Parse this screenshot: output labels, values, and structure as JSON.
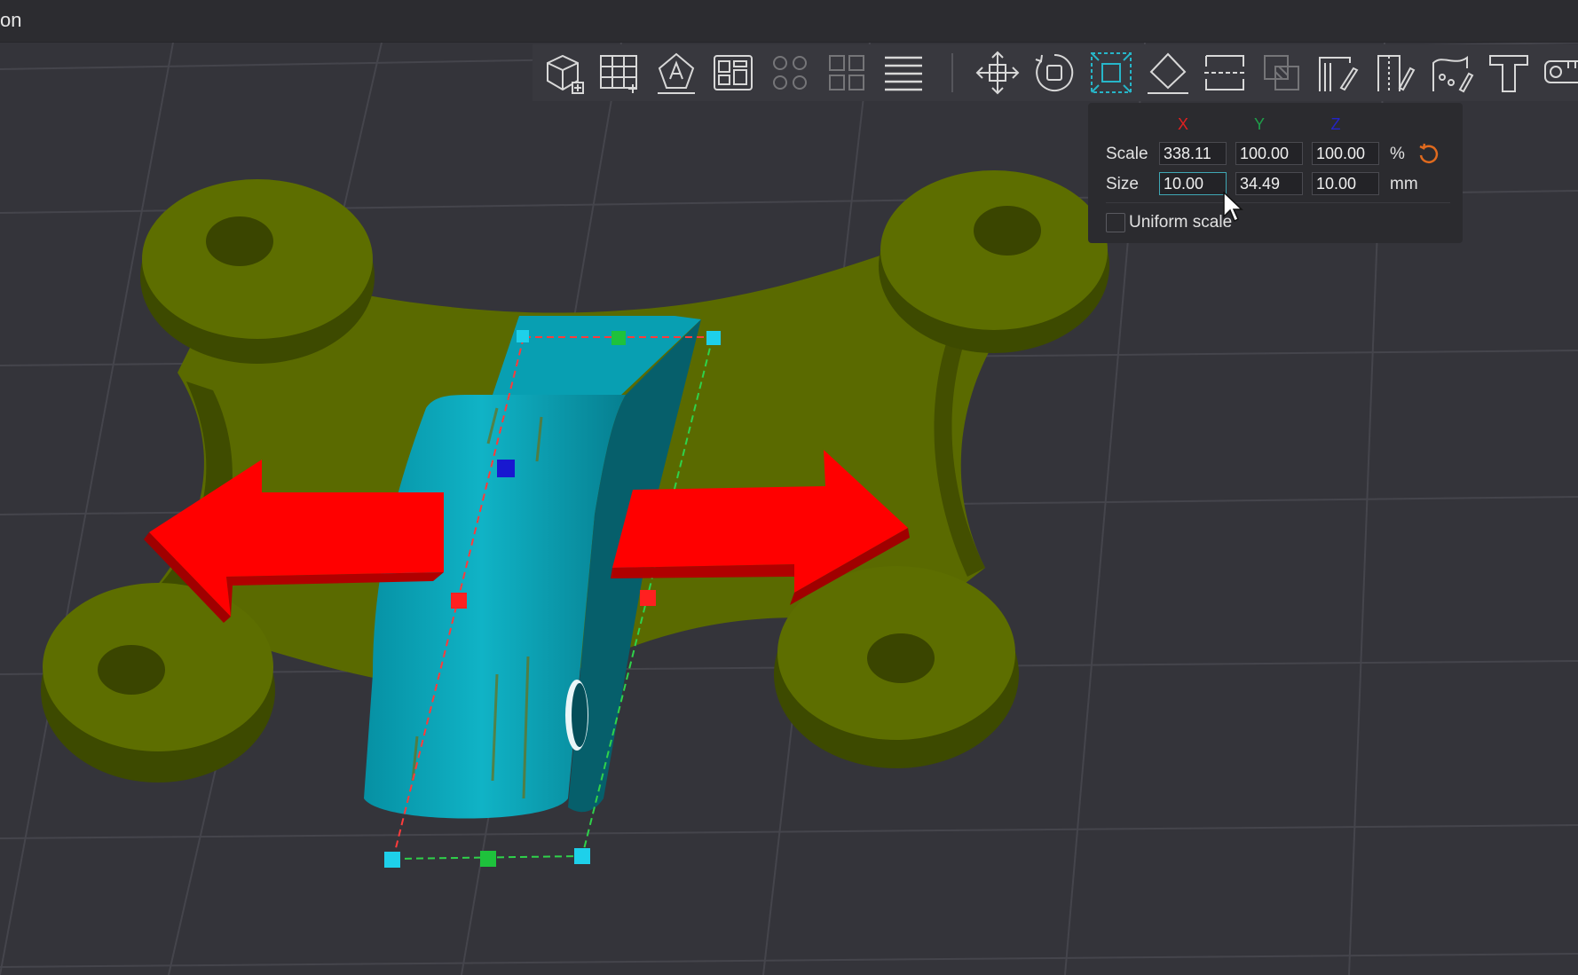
{
  "window": {
    "title": "on"
  },
  "toolbar": {
    "buttons": [
      {
        "name": "add-cube-icon"
      },
      {
        "name": "arrange-grid-icon"
      },
      {
        "name": "auto-orient-icon"
      },
      {
        "name": "plate-layout-icon"
      },
      {
        "name": "split-objects-icon"
      },
      {
        "name": "split-parts-icon"
      },
      {
        "name": "layers-icon"
      },
      {
        "name": "move-icon"
      },
      {
        "name": "rotate-icon"
      },
      {
        "name": "scale-icon"
      },
      {
        "name": "lay-on-face-icon"
      },
      {
        "name": "cut-icon"
      },
      {
        "name": "mesh-boolean-icon"
      },
      {
        "name": "support-paint-icon"
      },
      {
        "name": "seam-paint-icon"
      },
      {
        "name": "color-paint-icon"
      },
      {
        "name": "text-icon"
      },
      {
        "name": "measure-icon"
      }
    ]
  },
  "scale_panel": {
    "axis_x": "X",
    "axis_y": "Y",
    "axis_z": "Z",
    "scale_label": "Scale",
    "scale_x": "338.11",
    "scale_y": "100.00",
    "scale_z": "100.00",
    "scale_unit": "%",
    "size_label": "Size",
    "size_x": "10.00",
    "size_y": "34.49",
    "size_z": "10.00",
    "size_unit": "mm",
    "uniform_label": "Uniform scale",
    "uniform_checked": false
  },
  "colors": {
    "axis_x": "#e02020",
    "axis_y": "#1f9e4a",
    "axis_z": "#2424c8",
    "reset": "#e06a1e",
    "accent": "#27b6c9",
    "base_model": "#5a6a00",
    "selected_model": "#0aa3b6",
    "scale_arrows": "#ff0000"
  }
}
